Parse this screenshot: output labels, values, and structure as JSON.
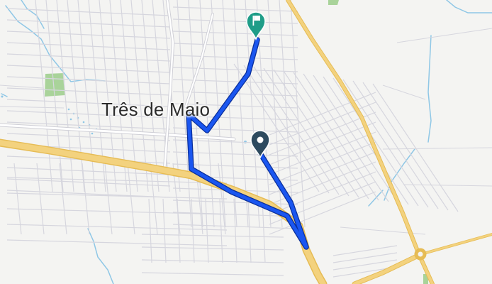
{
  "map": {
    "city_label": "Três de Maio",
    "colors": {
      "background": "#f4f4f2",
      "street": "#d6d6de",
      "highway_fill": "#f3d27e",
      "highway_casing": "#e6bc55",
      "water": "#8fc7e6",
      "park": "#a9d39a",
      "route": "#1a56f0",
      "route_casing": "#0b2f9a",
      "start_marker": "#2d4a5f",
      "end_marker": "#1f9d88"
    },
    "markers": {
      "start_icon": "location-pin-icon",
      "end_icon": "flag-pin-icon"
    }
  }
}
